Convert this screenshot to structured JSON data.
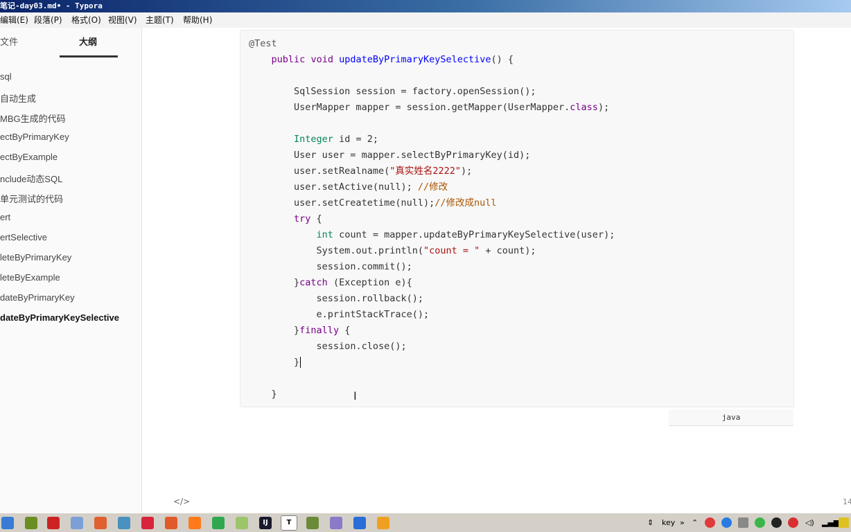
{
  "window": {
    "title": "笔记-day03.md• - Typora"
  },
  "menu": [
    "编辑(E)",
    "段落(P)",
    "格式(O)",
    "视图(V)",
    "主题(T)",
    "帮助(H)"
  ],
  "sidebar": {
    "tabs": [
      "文件",
      "大纲"
    ],
    "outline": [
      "sql",
      "自动生成",
      "MBG生成的代码",
      "ectByPrimaryKey",
      "ectByExample",
      "nclude动态SQL",
      "单元测试的代码",
      "ert",
      "ertSelective",
      "leteByPrimaryKey",
      "leteByExample",
      "dateByPrimaryKey",
      "dateByPrimaryKeySelective"
    ]
  },
  "code": {
    "language": "java",
    "t": {
      "ann": "@Test",
      "public": "public",
      "void": "void",
      "method_name": "updateByPrimaryKeySelective",
      "open_sig": "() {",
      "l4": "SqlSession session = factory.openSession();",
      "l5a": "UserMapper mapper = session.getMapper(UserMapper.",
      "l5b": "class",
      "l5c": ");",
      "integer": "Integer",
      "l7": " id = 2;",
      "l8": "User user = mapper.selectByPrimaryKey(id);",
      "l9a": "user.setRealname(",
      "l9b": "\"真实姓名2222\"",
      "l9c": ");",
      "l10a": "user.setActive(null); ",
      "l10b": "//修改",
      "l11a": "user.setCreatetime(null);",
      "l11b": "//修改成null",
      "try": "try",
      "brace_open": " {",
      "int": "int",
      "l13": " count = mapper.updateByPrimaryKeySelective(user);",
      "l14a": "System.out.println(",
      "l14b": "\"count = \"",
      "l14c": " + count);",
      "l15": "session.commit();",
      "brace_close": "}",
      "catch": "catch",
      "l16": " (Exception e){",
      "l17": "session.rollback();",
      "l18": "e.printStackTrace();",
      "finally": "finally",
      "l20": "session.close();",
      "l21": "}",
      "l23": "}"
    }
  },
  "status": {
    "word_count": "14"
  },
  "taskbar": {
    "apps": [
      "File Manager",
      "Notepad",
      "Office",
      "Paint",
      "Snipping",
      "Network",
      "Netease Music",
      "Browser",
      "Firefox",
      "Chrome",
      "Folder",
      "IntelliJ IDEA",
      "Typora",
      "Notepad++",
      "Terminal",
      "Tool",
      "Media"
    ],
    "typora_letter": "T",
    "idea_letter": "IJ",
    "tray_key": "key",
    "tray_arrows": "»"
  }
}
